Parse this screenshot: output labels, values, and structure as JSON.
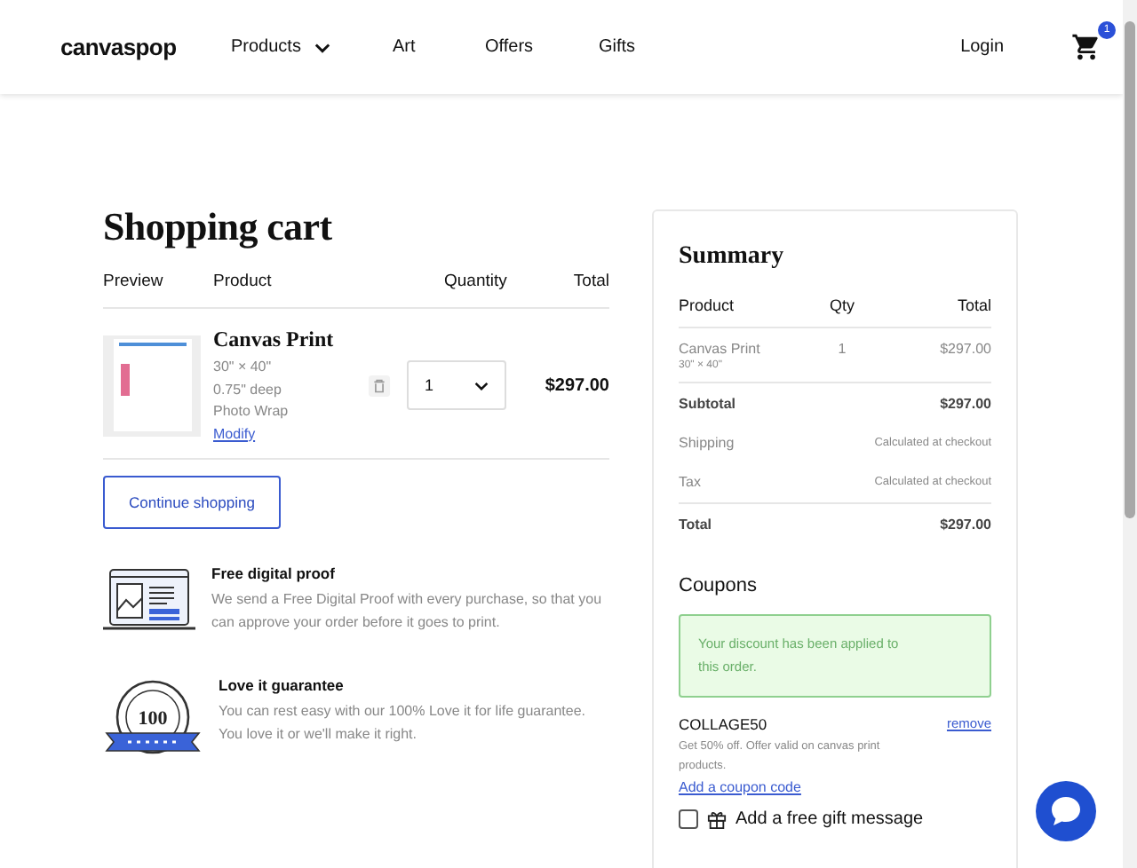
{
  "header": {
    "logo": "canvaspop",
    "nav": [
      {
        "label": "Products",
        "has_dropdown": true
      },
      {
        "label": "Art",
        "has_dropdown": false
      },
      {
        "label": "Offers",
        "has_dropdown": false
      },
      {
        "label": "Gifts",
        "has_dropdown": false
      }
    ],
    "login": "Login",
    "cart_count": "1"
  },
  "title": "Shopping cart",
  "cart": {
    "columns": [
      "Preview",
      "Product",
      "Quantity",
      "Total"
    ],
    "items": [
      {
        "name": "Canvas Print",
        "details": [
          "30\" × 40\"",
          "0.75\" deep",
          "Photo Wrap"
        ],
        "modify": "Modify",
        "quantity": "1",
        "total": "$297.00"
      }
    ]
  },
  "continue_button": "Continue shopping",
  "features": [
    {
      "kind": "proof",
      "title": "Free digital proof",
      "text": "We send a Free Digital Proof with every purchase, so that you can approve your order before it goes to print."
    },
    {
      "kind": "guarantee",
      "title": "Love it guarantee",
      "text": "You can rest easy with our 100% Love it for life guarantee. You love it or we'll make it right.",
      "badge": "100"
    }
  ],
  "summary": {
    "title": "Summary",
    "columns": [
      "Product",
      "Qty",
      "Total"
    ],
    "items": [
      {
        "name": "Canvas Print",
        "size": "30\" × 40\"",
        "qty": "1",
        "total": "$297.00"
      }
    ],
    "rows": [
      {
        "label": "Subtotal",
        "value": "$297.00",
        "kind": "strong"
      },
      {
        "label": "Shipping",
        "value": "Calculated at checkout",
        "kind": "note"
      },
      {
        "label": "Tax",
        "value": "Calculated at checkout",
        "kind": "note"
      },
      {
        "label": "Total",
        "value": "$297.00",
        "kind": "total"
      }
    ]
  },
  "coupons": {
    "title": "Coupons",
    "message": "Your discount has been applied to this order.",
    "code": "COLLAGE50",
    "remove": "remove",
    "description": "Get 50% off. Offer valid on canvas print products.",
    "add_link": "Add a coupon code"
  },
  "gift": {
    "label": "Add a free gift message",
    "checked": false
  }
}
